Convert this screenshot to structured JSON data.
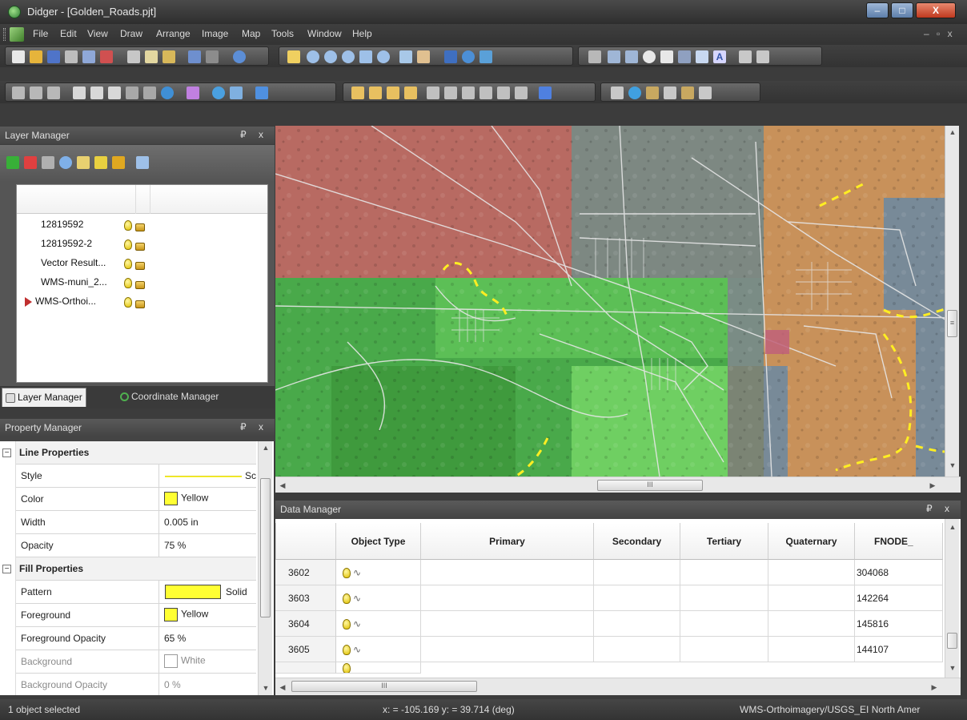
{
  "window": {
    "title": "Didger - [Golden_Roads.pjt]",
    "controls": {
      "minimize": "–",
      "maximize": "□",
      "close": "X"
    }
  },
  "menu": {
    "items": [
      "File",
      "Edit",
      "View",
      "Draw",
      "Arrange",
      "Image",
      "Map",
      "Tools",
      "Window",
      "Help"
    ],
    "mdi_controls": "– ▫ x"
  },
  "layer_manager": {
    "title": "Layer Manager",
    "pin": "₽ x",
    "layers": [
      {
        "name": "12819592",
        "active": false
      },
      {
        "name": "12819592-2",
        "active": false
      },
      {
        "name": "Vector Result...",
        "active": false
      },
      {
        "name": "WMS-muni_2...",
        "active": false
      },
      {
        "name": "WMS-Orthoi...",
        "active": true
      }
    ]
  },
  "tabs": {
    "layer_manager": "Layer Manager",
    "coordinate_manager": "Coordinate Manager"
  },
  "property_manager": {
    "title": "Property Manager",
    "pin": "₽ x",
    "sections": {
      "line": "Line Properties",
      "fill": "Fill Properties"
    },
    "line": {
      "style_key": "Style",
      "style_value": "Sc",
      "color_key": "Color",
      "color_value": "Yellow",
      "width_key": "Width",
      "width_value": "0.005 in",
      "opacity_key": "Opacity",
      "opacity_value": "75 %"
    },
    "fill": {
      "pattern_key": "Pattern",
      "pattern_value": "Solid",
      "foreground_key": "Foreground",
      "foreground_value": "Yellow",
      "fg_opacity_key": "Foreground Opacity",
      "fg_opacity_value": "65 %",
      "background_key": "Background",
      "background_value": "White",
      "bg_opacity_key": "Background Opacity",
      "bg_opacity_value": "0 %"
    },
    "colors": {
      "yellow": "#ffff33",
      "white": "#ffffff"
    }
  },
  "map": {
    "hscroll_label": "III",
    "vscroll_label": "≡"
  },
  "data_manager": {
    "title": "Data Manager",
    "pin": "₽ x",
    "columns": [
      "Object Type",
      "Primary",
      "Secondary",
      "Tertiary",
      "Quaternary",
      "FNODE_"
    ],
    "rows": [
      {
        "id": "3602",
        "fnode": "304068"
      },
      {
        "id": "3603",
        "fnode": "142264"
      },
      {
        "id": "3604",
        "fnode": "145816"
      },
      {
        "id": "3605",
        "fnode": "144107"
      }
    ],
    "hscroll_label": "III"
  },
  "status": {
    "selection": "1 object selected",
    "coords": "x: = -105.169 y: = 39.714 (deg)",
    "layer": "WMS-Orthoimagery/USGS_EI North Amer"
  }
}
